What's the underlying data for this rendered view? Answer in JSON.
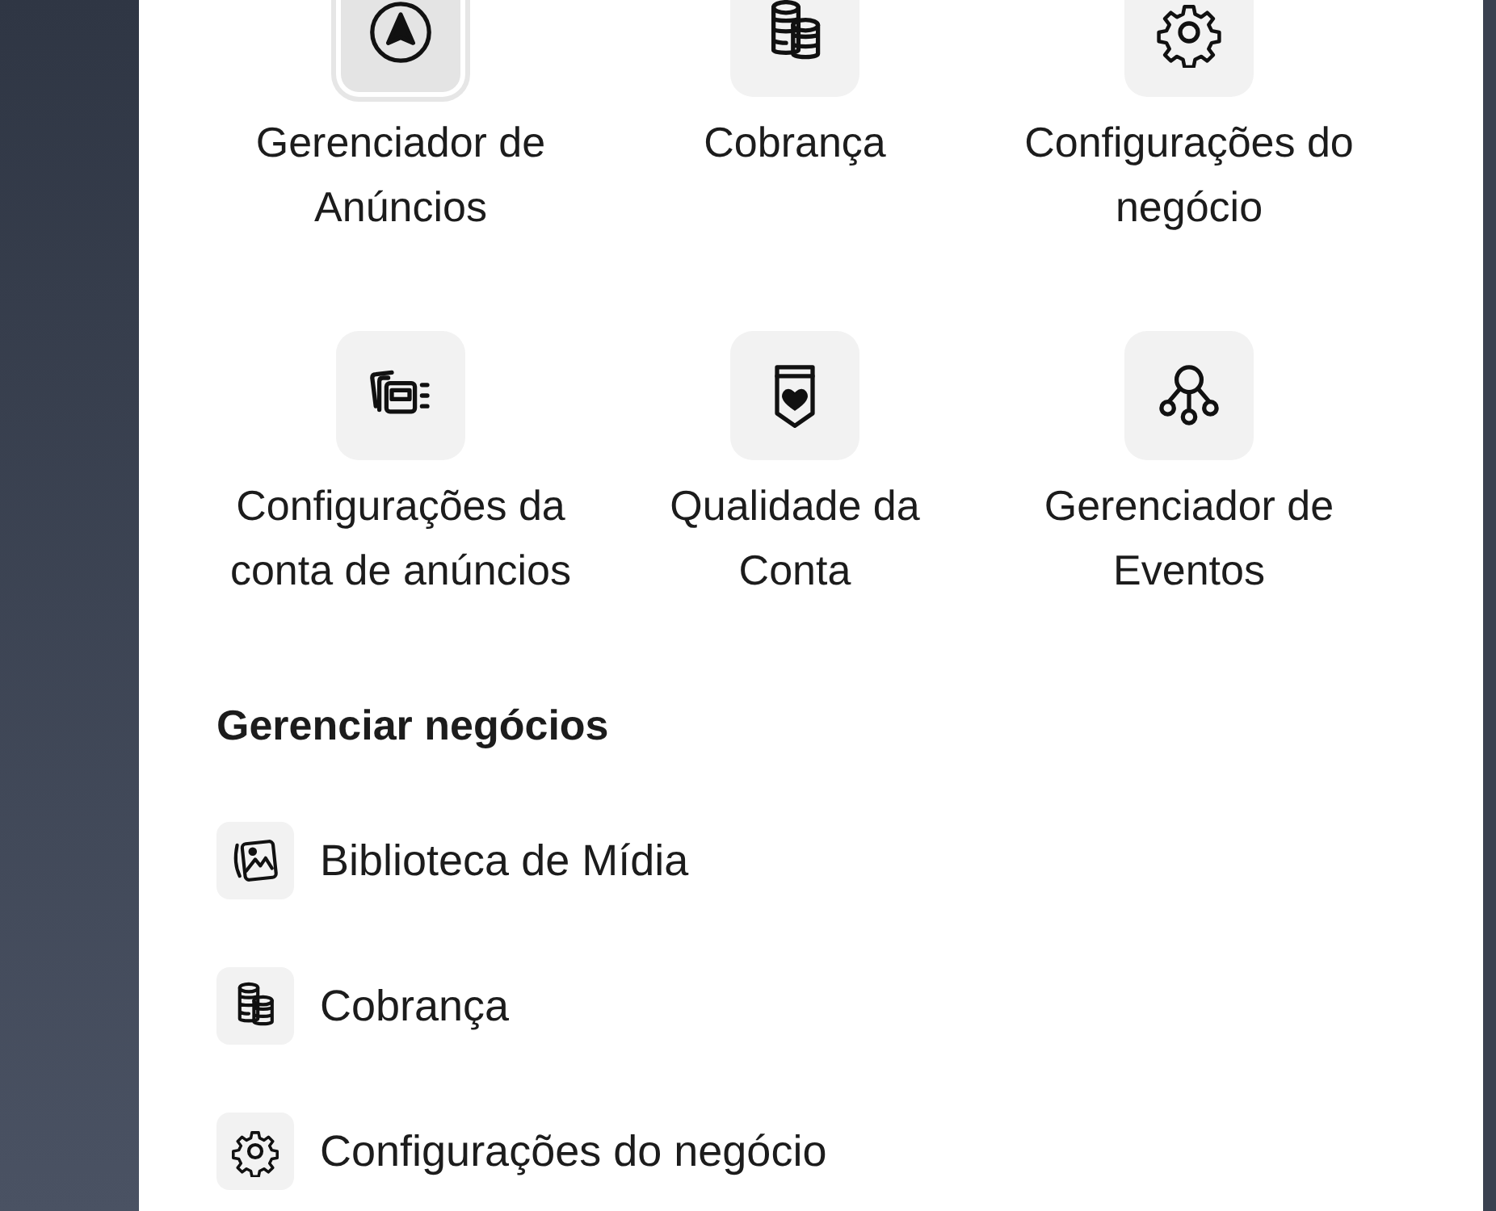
{
  "shortcuts": [
    {
      "label": "Gerenciador de Anúncios",
      "kind": "navigate",
      "selected": true
    },
    {
      "label": "Cobrança",
      "kind": "coins",
      "selected": false
    },
    {
      "label": "Configurações do negócio",
      "kind": "gear",
      "selected": false
    },
    {
      "label": "Configurações da conta de anúncios",
      "kind": "cards",
      "selected": false
    },
    {
      "label": "Qualidade da Conta",
      "kind": "shield",
      "selected": false
    },
    {
      "label": "Gerenciador de Eventos",
      "kind": "network",
      "selected": false
    }
  ],
  "section": {
    "title": "Gerenciar negócios",
    "items": [
      {
        "label": "Biblioteca de Mídia",
        "kind": "image"
      },
      {
        "label": "Cobrança",
        "kind": "coins"
      },
      {
        "label": "Configurações do negócio",
        "kind": "gear"
      }
    ]
  }
}
